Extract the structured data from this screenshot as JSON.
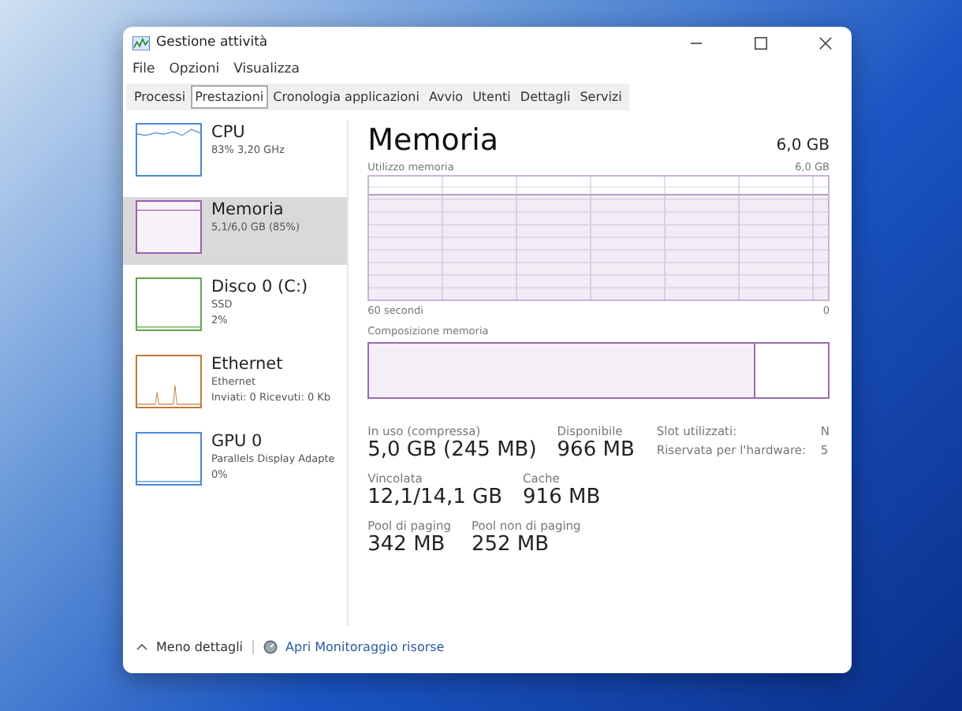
{
  "window": {
    "title": "Gestione attività"
  },
  "menu": [
    "File",
    "Opzioni",
    "Visualizza"
  ],
  "tabs": [
    {
      "label": "Processi",
      "selected": false
    },
    {
      "label": "Prestazioni",
      "selected": true
    },
    {
      "label": "Cronologia applicazioni",
      "selected": false
    },
    {
      "label": "Avvio",
      "selected": false
    },
    {
      "label": "Utenti",
      "selected": false
    },
    {
      "label": "Dettagli",
      "selected": false
    },
    {
      "label": "Servizi",
      "selected": false
    }
  ],
  "sidebar": {
    "items": [
      {
        "name": "CPU",
        "lines": [
          "83% 3,20 GHz"
        ],
        "color": "#4a8ad8",
        "selected": false
      },
      {
        "name": "Memoria",
        "lines": [
          "5,1/6,0 GB (85%)"
        ],
        "color": "#9a5fb0",
        "selected": true
      },
      {
        "name": "Disco 0 (C:)",
        "lines": [
          "SSD",
          "2%"
        ],
        "color": "#5fa84a",
        "selected": false
      },
      {
        "name": "Ethernet",
        "lines": [
          "Ethernet",
          "Inviati: 0 Ricevuti: 0 Kb"
        ],
        "color": "#c07a3a",
        "selected": false
      },
      {
        "name": "GPU 0",
        "lines": [
          "Parallels Display Adapte",
          "0%"
        ],
        "color": "#4a8ad8",
        "selected": false
      }
    ]
  },
  "detail": {
    "title": "Memoria",
    "total": "6,0 GB",
    "usage_graph": {
      "label": "Utilizzo memoria",
      "max_label": "6,0 GB",
      "left_label": "60 secondi",
      "right_label": "0"
    },
    "composition": {
      "label": "Composizione memoria",
      "level": 0.84
    },
    "stats": [
      [
        {
          "label": "In uso (compressa)",
          "value": "5,0 GB (245 MB)"
        },
        {
          "label": "Disponibile",
          "value": "966 MB"
        }
      ],
      [
        {
          "label": "Vincolata",
          "value": "12,1/14,1 GB"
        },
        {
          "label": "Cache",
          "value": "916 MB"
        }
      ],
      [
        {
          "label": "Pool di paging",
          "value": "342 MB"
        },
        {
          "label": "Pool non di paging",
          "value": "252 MB"
        }
      ]
    ],
    "info": [
      {
        "label": "Slot utilizzati:",
        "value": "N"
      },
      {
        "label": "Riservata per l'hardware:",
        "value": "5"
      }
    ]
  },
  "footer": {
    "less_details": "Meno dettagli",
    "resource_monitor": "Apri Monitoraggio risorse"
  }
}
